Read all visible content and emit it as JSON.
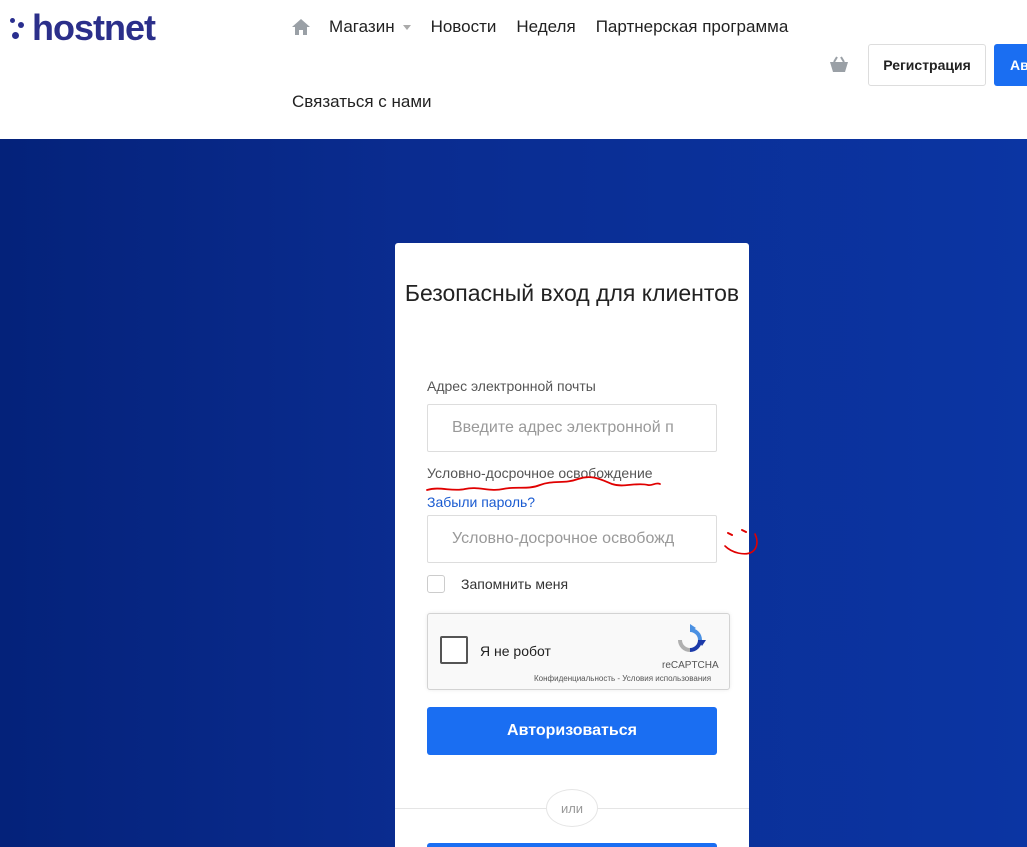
{
  "header": {
    "logo_text": "hostnet",
    "nav": {
      "home_icon": "home-icon",
      "items": [
        {
          "label": "Магазин",
          "has_dropdown": true
        },
        {
          "label": "Новости"
        },
        {
          "label": "Неделя"
        },
        {
          "label": "Партнерская программа"
        }
      ],
      "second_row": "Связаться с нами"
    },
    "cart_icon": "basket-icon",
    "register_label": "Регистрация",
    "auth_label": "Ав"
  },
  "colors": {
    "brand": "#2b2f8a",
    "accent": "#1a6ef2",
    "hero_dark": "#04227a",
    "hero_light": "#0b35a3",
    "annotation": "#e00000"
  },
  "login_card": {
    "title": "Безопасный вход для клиентов",
    "email_label": "Адрес электронной почты",
    "email_placeholder": "Введите адрес электронной п",
    "password_label": "Условно-досрочное освобождение",
    "forgot_link": "Забыли пароль?",
    "password_placeholder": "Условно-досрочное освобожд",
    "remember_label": "Запомнить меня",
    "captcha": {
      "label": "Я не робот",
      "brand": "reCAPTCHA",
      "links": "Конфиденциальность - Условия использования"
    },
    "submit_label": "Авторизоваться",
    "or_label": "или"
  }
}
